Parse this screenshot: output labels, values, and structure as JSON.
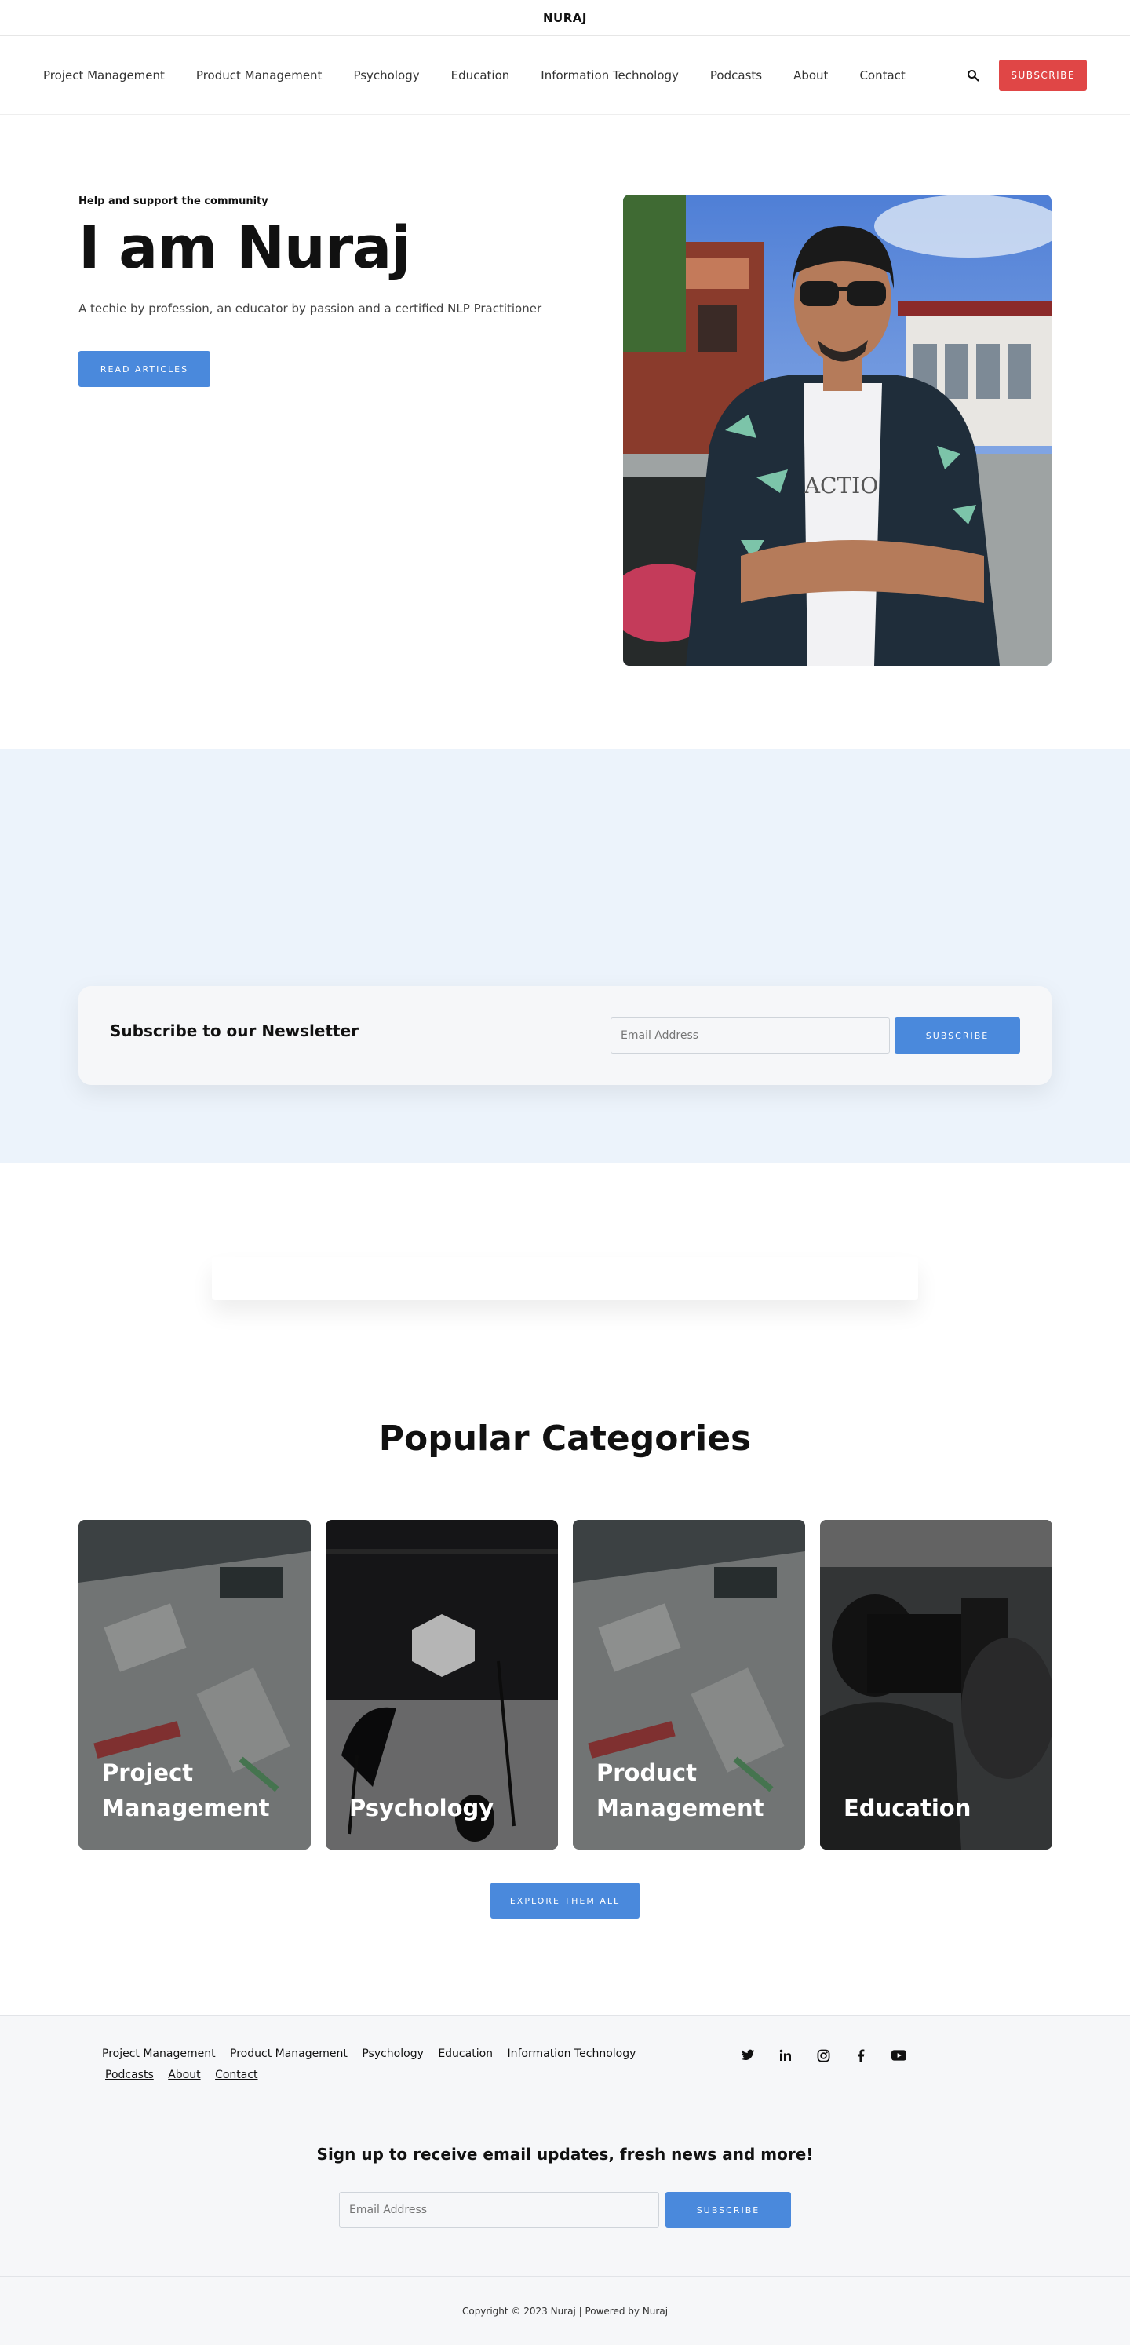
{
  "brand": "NURAJ",
  "nav": {
    "items": [
      "Project Management",
      "Product Management",
      "Psychology",
      "Education",
      "Information Technology",
      "Podcasts",
      "About",
      "Contact"
    ],
    "search_icon": "search-icon",
    "subscribe_label": "SUBSCRIBE"
  },
  "hero": {
    "eyebrow": "Help and support the community",
    "title": "I am Nuraj",
    "subtitle": "A techie by profession, an educator by passion and a certified NLP Practitioner",
    "button_label": "READ ARTICLES",
    "photo_shirt_text": "ACTIO"
  },
  "newsletter": {
    "title": "Subscribe to our Newsletter",
    "input_placeholder": "Email Address",
    "button_label": "SUBSCRIBE"
  },
  "categories": {
    "title": "Popular Categories",
    "items": [
      {
        "label": "Project Management"
      },
      {
        "label": "Psychology"
      },
      {
        "label": "Product Management"
      },
      {
        "label": "Education"
      }
    ],
    "button_label": "EXPLORE THEM ALL"
  },
  "footer": {
    "links": [
      "Project Management",
      "Product Management",
      "Psychology",
      "Education",
      "Information Technology",
      "Podcasts",
      "About",
      "Contact"
    ],
    "socials": [
      "twitter-icon",
      "linkedin-icon",
      "instagram-icon",
      "facebook-icon",
      "youtube-icon"
    ],
    "signup_title": "Sign up to receive email updates, fresh news and more!",
    "signup_placeholder": "Email Address",
    "signup_button": "SUBSCRIBE",
    "copyright": "Copyright © 2023 Nuraj | Powered by Nuraj"
  },
  "colors": {
    "accent": "#4a89dc",
    "subscribe_red": "#e04646",
    "band_bg": "#ecf3fb",
    "footer_bg": "#f6f7f9"
  }
}
